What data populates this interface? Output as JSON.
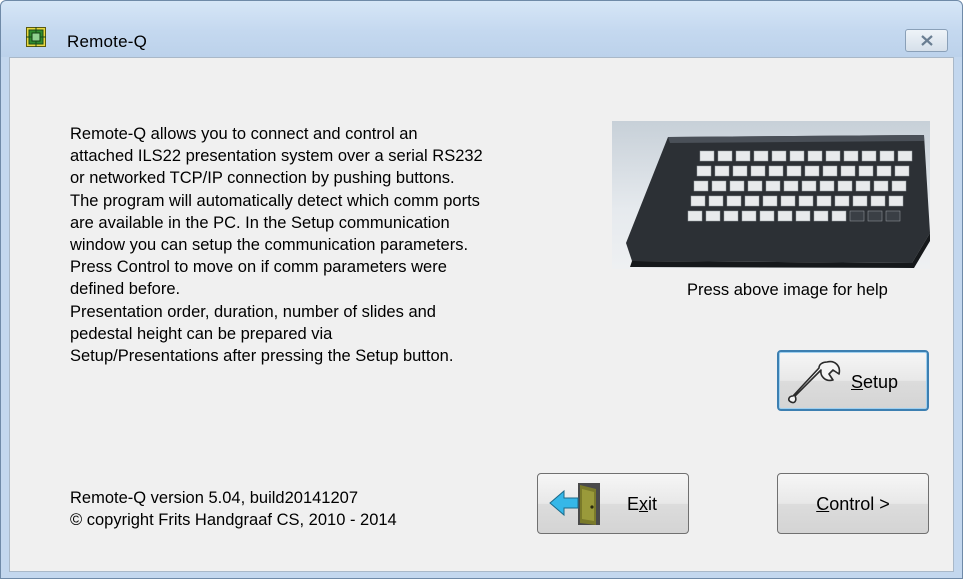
{
  "window": {
    "title": "Remote-Q",
    "app_icon": "circuit-board-icon",
    "close_icon": "close-icon"
  },
  "description": {
    "lines": [
      "Remote-Q allows you to connect and control an",
      "attached ILS22 presentation system over a serial RS232",
      "or networked TCP/IP connection by pushing buttons.",
      "The program will automatically detect which comm ports",
      "are available in the PC. In the Setup communication",
      "window you can setup the communication parameters.",
      "Press Control to move on if comm parameters were",
      "defined before.",
      "Presentation order, duration, number of slides and",
      "pedestal height can be prepared via",
      "Setup/Presentations after pressing the Setup button."
    ]
  },
  "help": {
    "image": "keypad-device-image",
    "caption": "Press above image for help"
  },
  "buttons": {
    "setup": {
      "accel": "S",
      "rest": "etup",
      "icon": "wrench-icon"
    },
    "exit": {
      "pre": "E",
      "accel": "x",
      "rest": "it",
      "icon": "exit-door-icon"
    },
    "control": {
      "accel": "C",
      "rest": "ontrol >"
    }
  },
  "version": {
    "line1": "Remote-Q version 5.04, build20141207",
    "line2": "© copyright Frits Handgraaf CS, 2010 - 2014"
  },
  "colors": {
    "titlebar": "#c4d8ef",
    "client_bg": "#f0f0f0",
    "focus_border": "#3c7fb1"
  }
}
